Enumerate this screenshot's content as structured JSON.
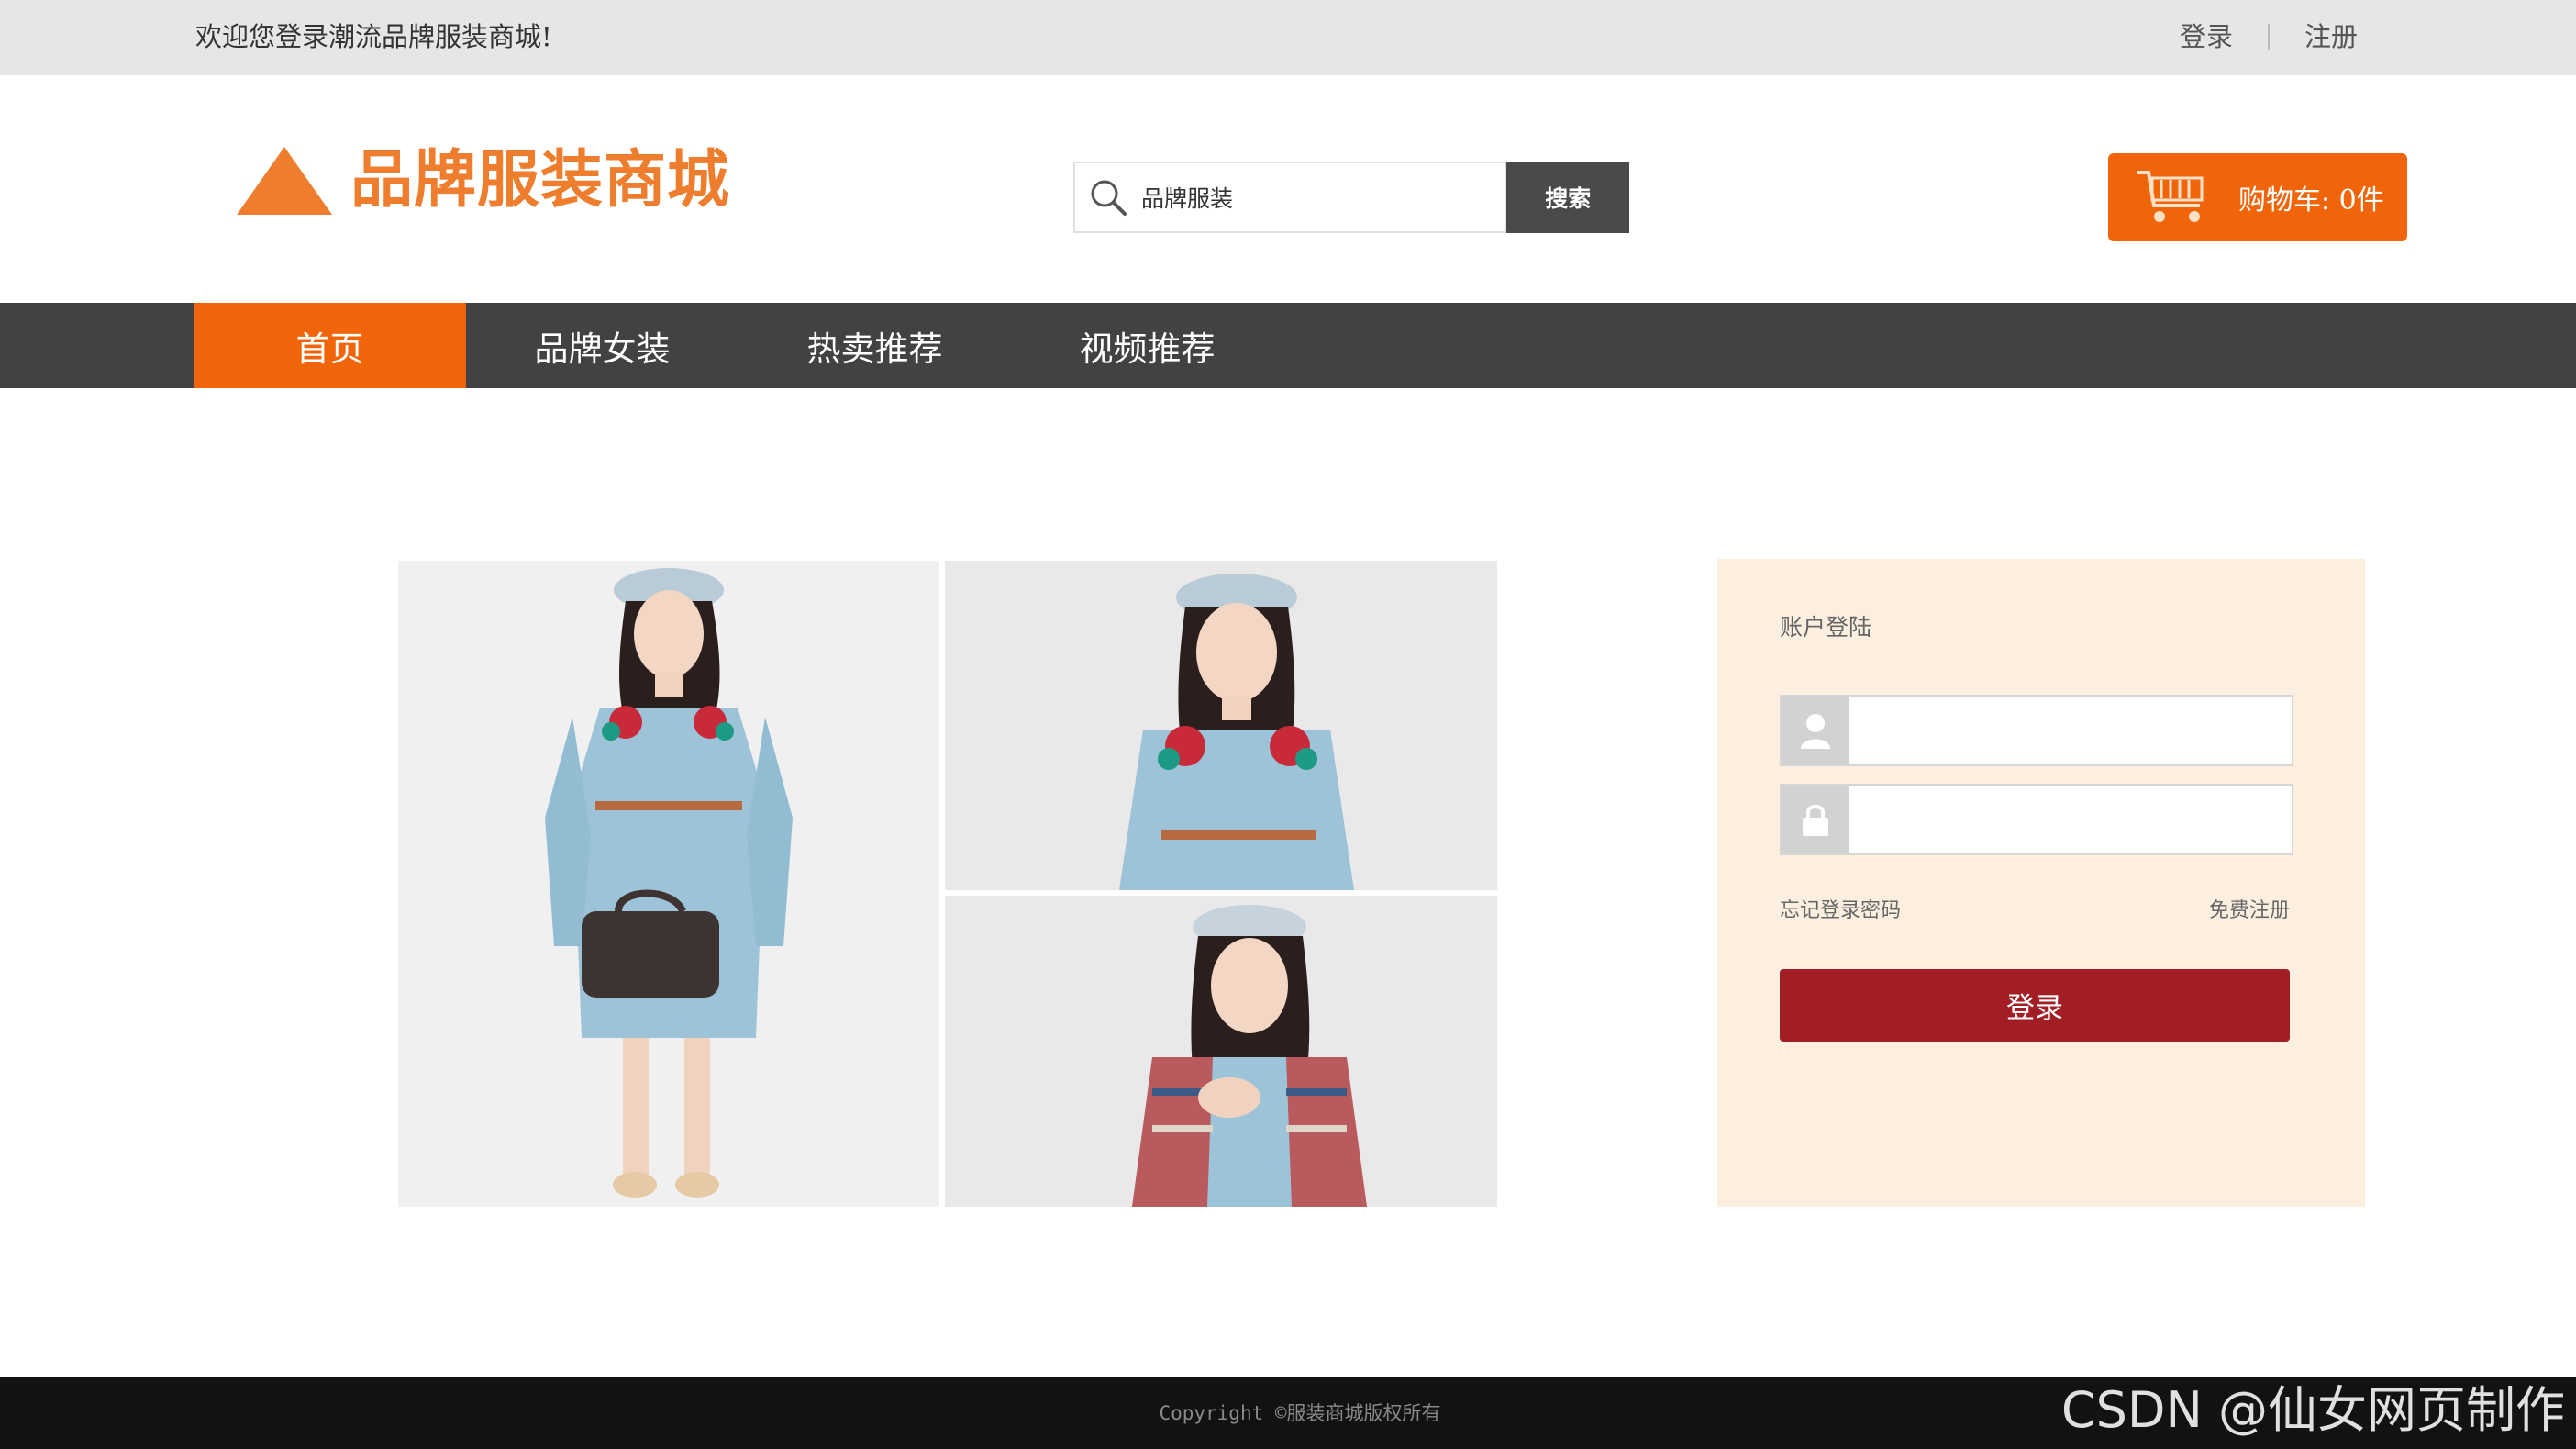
{
  "topbar": {
    "welcome": "欢迎您登录潮流品牌服装商城!",
    "login_link": "登录",
    "register_link": "注册"
  },
  "header": {
    "logo_text": "品牌服装商城",
    "search_value": "品牌服装",
    "search_button": "搜索",
    "cart_label": "购物车: 0件"
  },
  "nav": {
    "items": [
      {
        "label": "首页",
        "active": true
      },
      {
        "label": "品牌女装",
        "active": false
      },
      {
        "label": "热卖推荐",
        "active": false
      },
      {
        "label": "视频推荐",
        "active": false
      }
    ]
  },
  "login": {
    "title": "账户登陆",
    "forgot": "忘记登录密码",
    "register": "免费注册",
    "submit": "登录"
  },
  "footer": {
    "copyright": "Copyright ©服装商城版权所有"
  },
  "watermark": "CSDN @仙女网页制作",
  "colors": {
    "accent": "#f0640a",
    "logo": "#ef7d2e",
    "nav_bg": "#424245",
    "login_button": "#a31d24",
    "login_panel": "#fcefdf"
  }
}
